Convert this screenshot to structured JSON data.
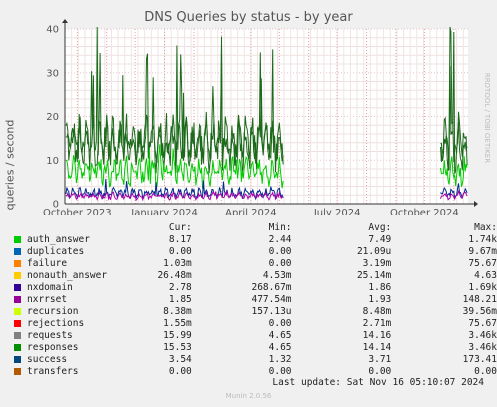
{
  "chart_data": {
    "type": "line",
    "title": "DNS Queries by status - by year",
    "ylabel": "queries / second",
    "ylim": [
      0,
      40
    ],
    "yticks": [
      "0",
      "10",
      "20",
      "30",
      "40"
    ],
    "xticks": [
      "October 2023",
      "January 2024",
      "April 2024",
      "July 2024",
      "October 2024"
    ],
    "x_range": [
      "2023-09-18",
      "2024-11-16"
    ],
    "grid": true,
    "data_gaps": [
      [
        "2024-05-05",
        "2024-10-18"
      ]
    ],
    "series": [
      {
        "name": "auth_answer",
        "color": "#00cc00",
        "values_approx": {
          "typical": 7.5,
          "low": 4,
          "high": 14
        }
      },
      {
        "name": "nxdomain",
        "color": "#002a8f",
        "values_approx": {
          "typical": 2.5,
          "low": 1,
          "high": 6
        }
      },
      {
        "name": "nxrrset",
        "color": "#aa00aa",
        "values_approx": {
          "typical": 1.8,
          "low": 0.5,
          "high": 3
        }
      },
      {
        "name": "requests",
        "color": "#1a6a1a",
        "values_approx": {
          "typical": 14,
          "low": 5,
          "high": 42
        }
      },
      {
        "name": "responses",
        "color": "#1a6a1a",
        "values_approx": {
          "typical": 14,
          "low": 5,
          "high": 42
        }
      }
    ]
  },
  "watermark": "RRDTOOL / TOBI OETIKER",
  "legend": {
    "headers": [
      "Cur:",
      "Min:",
      "Avg:",
      "Max:"
    ],
    "rows": [
      {
        "name": "auth_answer",
        "color": "#00cc00",
        "cur": "8.17",
        "min": "2.44",
        "avg": "7.49",
        "max": "1.74k"
      },
      {
        "name": "duplicates",
        "color": "#0066b3",
        "cur": "0.00",
        "min": "0.00",
        "avg": "21.09u",
        "max": "9.67m"
      },
      {
        "name": "failure",
        "color": "#ff8000",
        "cur": "1.03m",
        "min": "0.00",
        "avg": "3.19m",
        "max": "75.67"
      },
      {
        "name": "nonauth_answer",
        "color": "#ffcc00",
        "cur": "26.48m",
        "min": "4.53m",
        "avg": "25.14m",
        "max": "4.63"
      },
      {
        "name": "nxdomain",
        "color": "#330099",
        "cur": "2.78",
        "min": "268.67m",
        "avg": "1.86",
        "max": "1.69k"
      },
      {
        "name": "nxrrset",
        "color": "#990099",
        "cur": "1.85",
        "min": "477.54m",
        "avg": "1.93",
        "max": "148.21"
      },
      {
        "name": "recursion",
        "color": "#ccff00",
        "cur": "8.38m",
        "min": "157.13u",
        "avg": "8.48m",
        "max": "39.56m"
      },
      {
        "name": "rejections",
        "color": "#ff0000",
        "cur": "1.55m",
        "min": "0.00",
        "avg": "2.71m",
        "max": "75.67"
      },
      {
        "name": "requests",
        "color": "#808080",
        "cur": "15.99",
        "min": "4.65",
        "avg": "14.16",
        "max": "3.46k"
      },
      {
        "name": "responses",
        "color": "#008f00",
        "cur": "15.53",
        "min": "4.65",
        "avg": "14.14",
        "max": "3.46k"
      },
      {
        "name": "success",
        "color": "#00487d",
        "cur": "3.54",
        "min": "1.32",
        "avg": "3.71",
        "max": "173.41"
      },
      {
        "name": "transfers",
        "color": "#b35a00",
        "cur": "0.00",
        "min": "0.00",
        "avg": "0.00",
        "max": "0.00"
      }
    ]
  },
  "last_update": "Last update: Sat Nov 16 05:10:07 2024",
  "version": "Munin 2.0.56"
}
